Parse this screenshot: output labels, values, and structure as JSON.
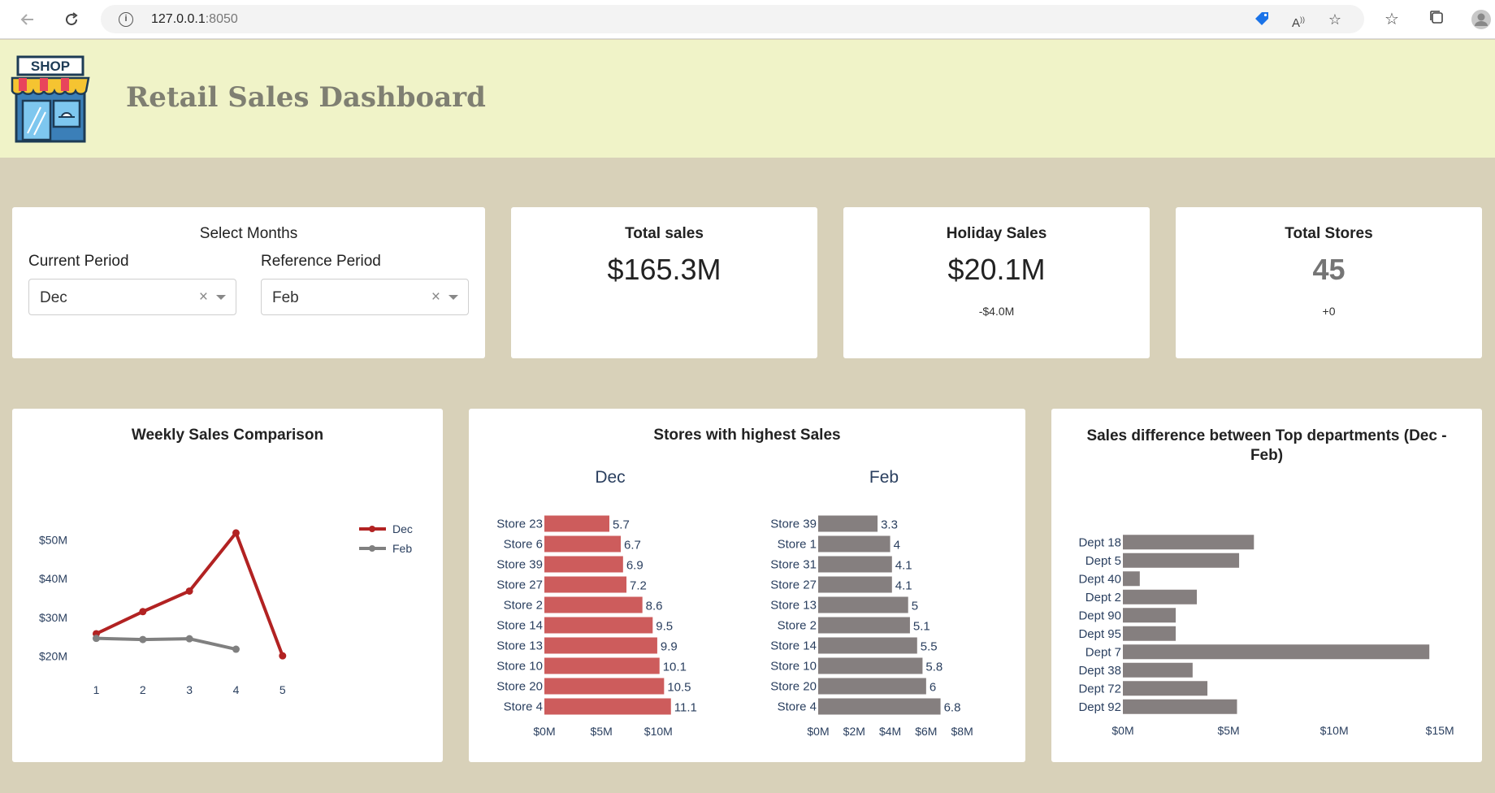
{
  "browser": {
    "url_host": "127.0.0.1",
    "url_port": ":8050",
    "icons": [
      "back-icon",
      "reload-icon",
      "info-icon",
      "tag-icon",
      "read-aloud-icon",
      "add-favorite-icon",
      "favorites-icon",
      "collections-icon",
      "profile-icon"
    ]
  },
  "header": {
    "title": "Retail Sales Dashboard",
    "logo_text": "SHOP"
  },
  "select_months": {
    "title": "Select Months",
    "current_label": "Current Period",
    "current_value": "Dec",
    "reference_label": "Reference Period",
    "reference_value": "Feb",
    "clear_glyph": "×"
  },
  "kpis": {
    "total_sales": {
      "title": "Total sales",
      "value": "$165.3M"
    },
    "holiday_sales": {
      "title": "Holiday Sales",
      "value": "$20.1M",
      "delta": "-$4.0M"
    },
    "total_stores": {
      "title": "Total Stores",
      "value": "45",
      "delta": "+0"
    }
  },
  "colors": {
    "current": "#b22222",
    "reference": "#808080",
    "bar_current": "#cd5c5c",
    "bar_reference": "#857f7f",
    "bar_dept": "#857f7f",
    "header_bg": "#f0f3c8",
    "page_bg": "#d8d1b9"
  },
  "chart_data": [
    {
      "type": "line",
      "title": "Weekly Sales Comparison",
      "x": [
        1,
        2,
        3,
        4,
        5
      ],
      "x_ticks": [
        "1",
        "2",
        "3",
        "4",
        "5"
      ],
      "y_ticks": [
        "$20M",
        "$30M",
        "$40M",
        "$50M"
      ],
      "y_tick_values": [
        20,
        30,
        40,
        50
      ],
      "ylim": [
        17.2,
        54.5
      ],
      "xlim": [
        0.8,
        5.3
      ],
      "legend": "top-right",
      "series": [
        {
          "name": "Dec",
          "x": [
            1,
            2,
            3,
            4,
            5
          ],
          "values": [
            25.8,
            31.5,
            36.8,
            51.8,
            20.1
          ]
        },
        {
          "name": "Feb",
          "x": [
            1,
            2,
            3,
            4
          ],
          "values": [
            24.6,
            24.3,
            24.5,
            21.8
          ]
        }
      ]
    },
    {
      "type": "bar",
      "title": "Stores with highest Sales",
      "subplot_title": "Dec",
      "orientation": "horizontal",
      "categories": [
        "Store 4",
        "Store 20",
        "Store 10",
        "Store 13",
        "Store 14",
        "Store 2",
        "Store 27",
        "Store 39",
        "Store 6",
        "Store 23"
      ],
      "values": [
        11.1,
        10.5,
        10.1,
        9.9,
        9.5,
        8.6,
        7.2,
        6.9,
        6.7,
        5.7
      ],
      "data_labels": [
        "11.1",
        "10.5",
        "10.1",
        "9.9",
        "9.5",
        "8.6",
        "7.2",
        "6.9",
        "6.7",
        "5.7"
      ],
      "x_ticks": [
        "$0M",
        "$5M",
        "$10M"
      ],
      "x_tick_values": [
        0,
        5,
        10
      ],
      "xlim": [
        0,
        12.4
      ]
    },
    {
      "type": "bar",
      "title": "Stores with highest Sales",
      "subplot_title": "Feb",
      "orientation": "horizontal",
      "categories": [
        "Store 4",
        "Store 20",
        "Store 10",
        "Store 14",
        "Store 2",
        "Store 13",
        "Store 27",
        "Store 31",
        "Store 1",
        "Store 39"
      ],
      "values": [
        6.8,
        6,
        5.8,
        5.5,
        5.1,
        5,
        4.1,
        4.1,
        4,
        3.3
      ],
      "data_labels": [
        "6.8",
        "6",
        "5.8",
        "5.5",
        "5.1",
        "5",
        "4.1",
        "4.1",
        "4",
        "3.3"
      ],
      "x_ticks": [
        "$0M",
        "$2M",
        "$4M",
        "$6M",
        "$8M"
      ],
      "x_tick_values": [
        0,
        2,
        4,
        6,
        8
      ],
      "xlim": [
        0,
        8.4
      ]
    },
    {
      "type": "bar",
      "title": "Sales difference between Top departments (Dec - Feb)",
      "title_lines": [
        "Sales difference between Top departments (Dec -",
        "Feb)"
      ],
      "orientation": "horizontal",
      "categories": [
        "Dept 92",
        "Dept 72",
        "Dept 38",
        "Dept 7",
        "Dept 95",
        "Dept 90",
        "Dept 2",
        "Dept 40",
        "Dept 5",
        "Dept 18"
      ],
      "values": [
        5.4,
        4.0,
        3.3,
        14.5,
        2.5,
        2.5,
        3.5,
        0.8,
        5.5,
        6.2
      ],
      "x_ticks": [
        "$0M",
        "$5M",
        "$10M",
        "$15M"
      ],
      "x_tick_values": [
        0,
        5,
        10,
        15
      ],
      "xlim": [
        0,
        15.3
      ]
    }
  ]
}
